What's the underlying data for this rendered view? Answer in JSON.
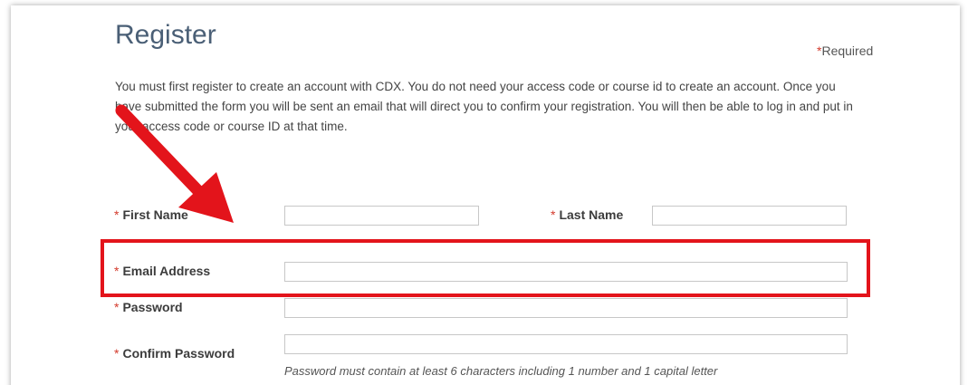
{
  "page": {
    "title": "Register",
    "required_star": "*",
    "required_text": "Required",
    "intro": "You must first register to create an account with CDX. You do not need your access code or course id to create an account. Once you have submitted the form you will be sent an email that will direct you to confirm your registration. You will then be able to log in and put in your access code or course ID at that time."
  },
  "form": {
    "required_marker": "*",
    "first_name_label": "First Name",
    "last_name_label": "Last Name",
    "email_label": "Email Address",
    "password_label": "Password",
    "confirm_password_label": "Confirm Password",
    "first_name_value": "",
    "last_name_value": "",
    "email_value": "",
    "password_value": "",
    "confirm_password_value": "",
    "password_hint": "Password must contain at least 6 characters including 1 number and 1 capital letter"
  },
  "annotations": {
    "arrow_color": "#e3141b",
    "highlight_color": "#e3141b"
  }
}
